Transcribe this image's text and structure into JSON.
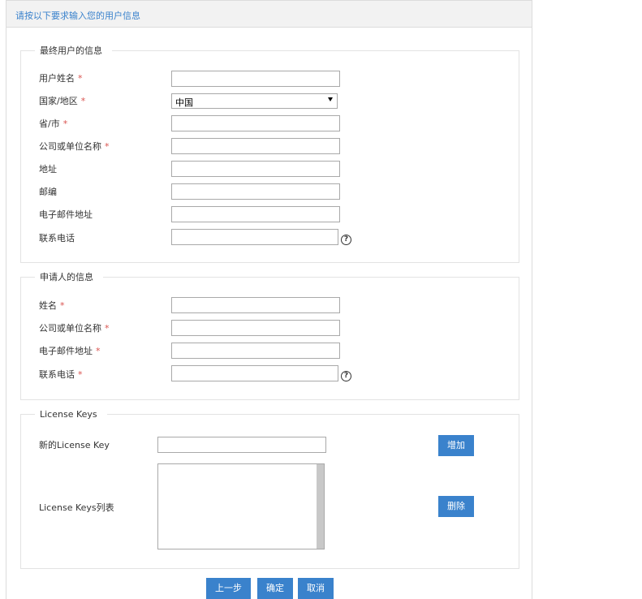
{
  "header": {
    "title": "请按以下要求输入您的用户信息"
  },
  "end_user": {
    "legend": "最终用户的信息",
    "fields": [
      {
        "label": "用户姓名",
        "required": true,
        "value": ""
      },
      {
        "label": "国家/地区",
        "required": true,
        "value": "中国",
        "type": "select"
      },
      {
        "label": "省/市",
        "required": true,
        "value": ""
      },
      {
        "label": "公司或单位名称",
        "required": true,
        "value": ""
      },
      {
        "label": "地址",
        "required": false,
        "value": ""
      },
      {
        "label": "邮编",
        "required": false,
        "value": ""
      },
      {
        "label": "电子邮件地址",
        "required": false,
        "value": ""
      },
      {
        "label": "联系电话",
        "required": false,
        "value": "",
        "help": "?"
      }
    ]
  },
  "applicant": {
    "legend": "申请人的信息",
    "fields": [
      {
        "label": "姓名",
        "required": true,
        "value": ""
      },
      {
        "label": "公司或单位名称",
        "required": true,
        "value": ""
      },
      {
        "label": "电子邮件地址",
        "required": true,
        "value": ""
      },
      {
        "label": "联系电话",
        "required": true,
        "value": "",
        "help": "?"
      }
    ]
  },
  "license": {
    "legend": "License Keys",
    "new_key_label": "新的License Key",
    "new_key_value": "",
    "add_button": "增加",
    "list_label": "License Keys列表",
    "delete_button": "删除",
    "list_items": []
  },
  "footer": {
    "prev_button": "上一步",
    "ok_button": "确定",
    "cancel_button": "取消"
  },
  "required_mark": "*",
  "colors": {
    "accent": "#3a82cc",
    "required": "#d9534f",
    "header_bg": "#f2f2f2"
  }
}
